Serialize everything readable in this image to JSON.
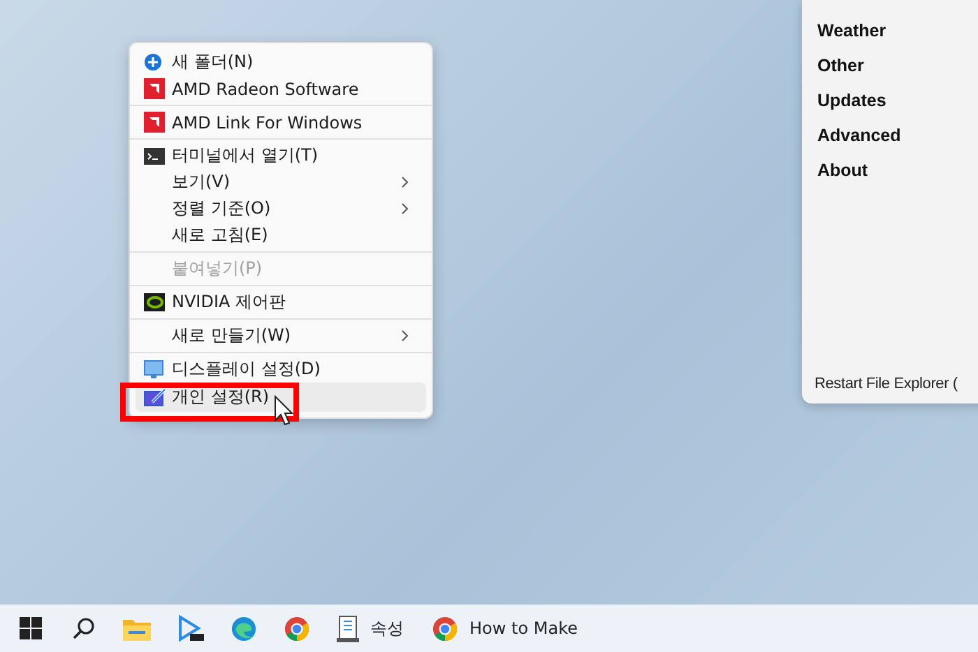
{
  "context_menu": {
    "sections": [
      {
        "items": [
          {
            "label": "새 폴더(N)",
            "kind": "blue-dot",
            "submenu": false,
            "disabled": false,
            "selected": false
          },
          {
            "label": "AMD Radeon Software",
            "kind": "red-tile",
            "submenu": false,
            "disabled": false,
            "selected": false
          }
        ]
      },
      {
        "items": [
          {
            "label": "AMD Link For Windows",
            "kind": "red-tile",
            "submenu": false,
            "disabled": false,
            "selected": false
          }
        ]
      },
      {
        "items": [
          {
            "label": "터미널에서 열기(T)",
            "kind": "terminal",
            "submenu": false,
            "disabled": false,
            "selected": false
          },
          {
            "label": "보기(V)",
            "kind": "none",
            "submenu": true,
            "disabled": false,
            "selected": false
          },
          {
            "label": "정렬 기준(O)",
            "kind": "none",
            "submenu": true,
            "disabled": false,
            "selected": false
          },
          {
            "label": "새로 고침(E)",
            "kind": "none",
            "submenu": false,
            "disabled": false,
            "selected": false
          }
        ]
      },
      {
        "items": [
          {
            "label": "붙여넣기(P)",
            "kind": "none",
            "submenu": false,
            "disabled": true,
            "selected": false
          }
        ]
      },
      {
        "items": [
          {
            "label": "NVIDIA 제어판",
            "kind": "green-tile",
            "submenu": false,
            "disabled": false,
            "selected": false
          }
        ]
      },
      {
        "items": [
          {
            "label": "새로 만들기(W)",
            "kind": "none",
            "submenu": true,
            "disabled": false,
            "selected": false
          }
        ]
      },
      {
        "items": [
          {
            "label": "디스플레이 설정(D)",
            "kind": "monitor",
            "submenu": false,
            "disabled": false,
            "selected": false
          },
          {
            "label": "개인 설정(R)",
            "kind": "brush",
            "submenu": false,
            "disabled": false,
            "selected": true
          }
        ]
      }
    ]
  },
  "side_panel": {
    "items": [
      "Weather",
      "Other",
      "Updates",
      "Advanced",
      "About"
    ],
    "footer": "Restart File Explorer ("
  },
  "taskbar": {
    "apps": [
      {
        "kind": "start"
      },
      {
        "kind": "search"
      },
      {
        "kind": "folder"
      },
      {
        "kind": "player"
      },
      {
        "kind": "edge"
      },
      {
        "kind": "chrome"
      },
      {
        "kind": "doc",
        "label": "속성"
      },
      {
        "kind": "chrome",
        "label": "How to Make"
      }
    ]
  }
}
